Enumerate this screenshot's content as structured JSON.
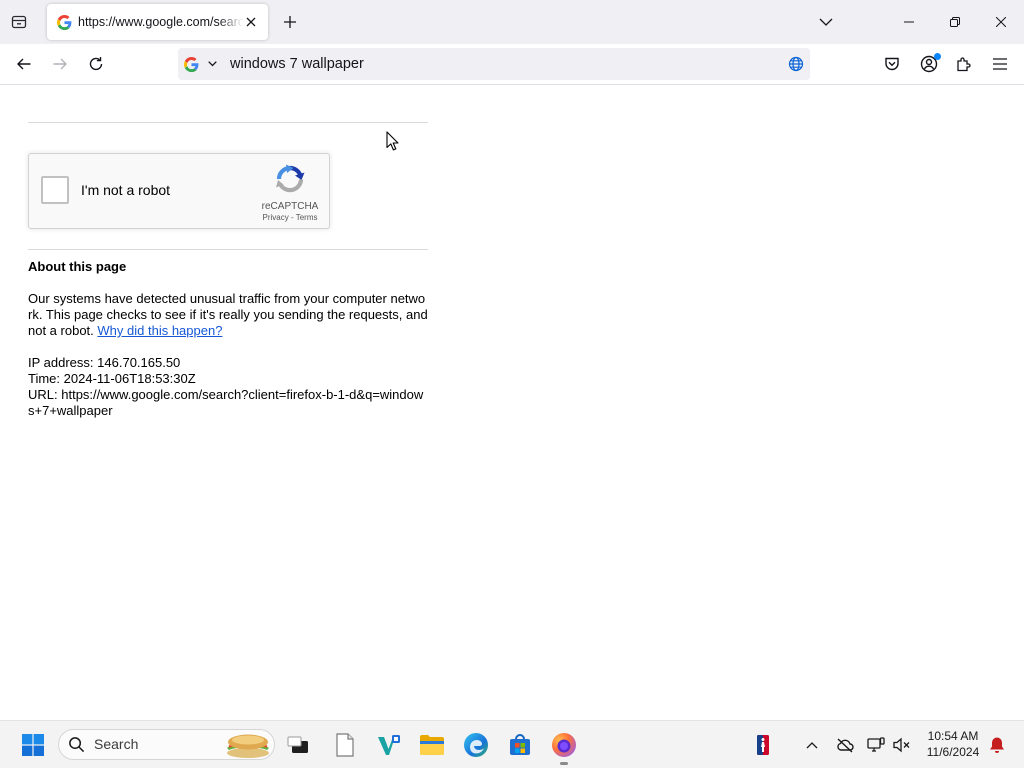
{
  "browser": {
    "tabs": [
      {
        "title": "https://www.google.com/searc",
        "favicon": "google-g-icon",
        "active": true
      }
    ],
    "url_bar": {
      "value": "windows 7 wallpaper",
      "search_engine_icon": "google-g-icon"
    },
    "forward_enabled": false,
    "toolbar_icons": [
      "firefox-view-icon",
      "tab-close-icon",
      "new-tab-icon",
      "list-all-tabs-icon",
      "minimize-icon",
      "restore-icon",
      "close-icon",
      "back-icon",
      "forward-icon",
      "reload-icon",
      "chevron-down-icon",
      "translate-globe-icon",
      "pocket-icon",
      "account-icon",
      "extensions-icon",
      "menu-icon"
    ]
  },
  "page": {
    "recaptcha": {
      "checkbox_label": "I'm not a robot",
      "checked": false,
      "brand": "reCAPTCHA",
      "privacy_link": "Privacy",
      "separator": "-",
      "terms_link": "Terms",
      "logo_icon": "recaptcha-logo-icon"
    },
    "about": {
      "heading": "About this page",
      "message": "Our systems have detected unusual traffic from your computer network. This page checks to see if it's really you sending the requests, and not a robot.",
      "why_link": "Why did this happen?"
    },
    "details": {
      "ip_label": "IP address:",
      "ip": "146.70.165.50",
      "time_label": "Time:",
      "time": "2024-11-06T18:53:30Z",
      "url_label": "URL:",
      "url": "https://www.google.com/search?client=firefox-b-1-d&q=windows+7+wallpaper"
    }
  },
  "taskbar": {
    "start_icon": "windows-start-icon",
    "search": {
      "label": "Search",
      "highlight_icon": "search-highlight-image"
    },
    "pinned_apps": [
      {
        "icon": "task-view-icon"
      },
      {
        "icon": "notepad-icon"
      },
      {
        "icon": "vs-app-icon"
      },
      {
        "icon": "file-explorer-icon"
      },
      {
        "icon": "edge-icon"
      },
      {
        "icon": "microsoft-store-icon"
      },
      {
        "icon": "firefox-icon",
        "active": true
      }
    ],
    "tray_icons": [
      "nba-icon",
      "chevron-up-icon",
      "cloud-offline-icon",
      "network-monitor-icon",
      "volume-muted-icon",
      "notification-bell-icon"
    ],
    "clock": {
      "time": "10:54 AM",
      "date": "11/6/2024"
    }
  },
  "cursor": {
    "icon": "mouse-pointer-icon"
  },
  "colors": {
    "chrome_bg": "#f0f0f4",
    "text": "#15141a",
    "link": "#1558d6",
    "recaptcha_dark_blue": "#1c3aa9",
    "recaptcha_light_blue": "#4a90e2",
    "recaptcha_gray": "#ababab",
    "taskbar_bg": "#f3f3f3",
    "start_blue": "#1b8ae8",
    "notification_red": "#c41e1e"
  }
}
